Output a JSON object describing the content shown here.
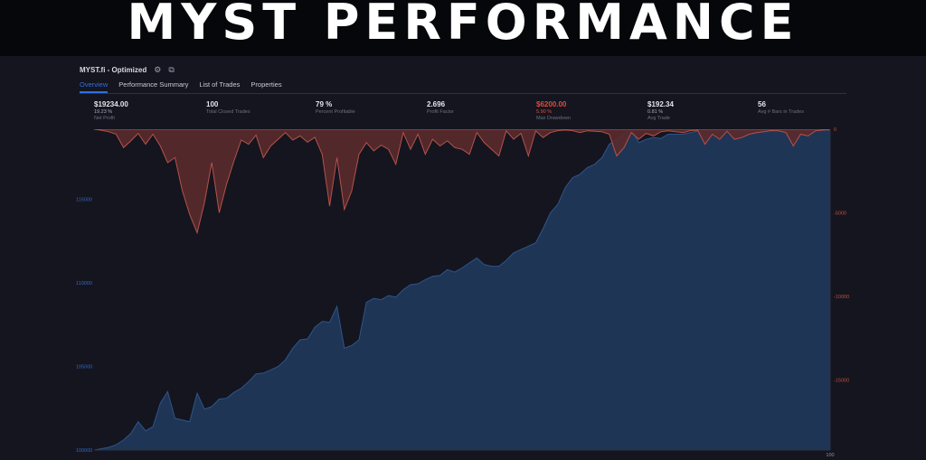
{
  "banner": {
    "title": "MYST PERFORMANCE"
  },
  "header": {
    "strategy_name": "MYST.fi - Optimized",
    "settings_icon": "gear-icon",
    "compare_icon": "chart-compare-icon"
  },
  "tabs": [
    {
      "label": "Overview",
      "active": true
    },
    {
      "label": "Performance Summary",
      "active": false
    },
    {
      "label": "List of Trades",
      "active": false
    },
    {
      "label": "Properties",
      "active": false
    }
  ],
  "metrics": [
    {
      "value": "$19234.00",
      "sub": "19.23 %",
      "label": "Net Profit"
    },
    {
      "value": "100",
      "sub": "",
      "label": "Total Closed Trades"
    },
    {
      "value": "79 %",
      "sub": "",
      "label": "Percent Profitable"
    },
    {
      "value": "2.696",
      "sub": "",
      "label": "Profit Factor"
    },
    {
      "value": "$6200.00",
      "sub": "5.90 %",
      "label": "Max Drawdown",
      "negative": true
    },
    {
      "value": "$192.34",
      "sub": "0.81 %",
      "label": "Avg Trade"
    },
    {
      "value": "56",
      "sub": "",
      "label": "Avg # Bars in Trades"
    }
  ],
  "colors": {
    "equity_fill": "#1f3556",
    "equity_line": "#2f5488",
    "drawdown_fill": "#5a2a2c",
    "drawdown_line": "#b5524a",
    "left_axis": "#3569c2",
    "right_axis": "#c0503f"
  },
  "chart_data": {
    "type": "area",
    "title": "",
    "x": [
      0,
      1,
      2,
      3,
      4,
      5,
      6,
      7,
      8,
      9,
      10,
      11,
      12,
      13,
      14,
      15,
      16,
      17,
      18,
      19,
      20,
      21,
      22,
      23,
      24,
      25,
      26,
      27,
      28,
      29,
      30,
      31,
      32,
      33,
      34,
      35,
      36,
      37,
      38,
      39,
      40,
      41,
      42,
      43,
      44,
      45,
      46,
      47,
      48,
      49,
      50,
      51,
      52,
      53,
      54,
      55,
      56,
      57,
      58,
      59,
      60,
      61,
      62,
      63,
      64,
      65,
      66,
      67,
      68,
      69,
      70,
      71,
      72,
      73,
      74,
      75,
      76,
      77,
      78,
      79,
      80,
      81,
      82,
      83,
      84,
      85,
      86,
      87,
      88,
      89,
      90,
      91,
      92,
      93,
      94,
      95,
      96,
      97,
      98,
      99,
      100
    ],
    "x_tick_labels": [
      "100"
    ],
    "left_axis": {
      "ticks": [
        {
          "value": 100000,
          "label": "100000"
        },
        {
          "value": 105000,
          "label": "105000"
        },
        {
          "value": 110000,
          "label": "110000"
        },
        {
          "value": 115000,
          "label": "115000"
        }
      ],
      "ylim": [
        100000,
        119200
      ]
    },
    "right_axis": {
      "ticks": [
        {
          "value": 0,
          "label": "0"
        },
        {
          "value": -5000,
          "label": "-5000"
        },
        {
          "value": -10000,
          "label": "-10000"
        },
        {
          "value": -15000,
          "label": "-15000"
        }
      ],
      "ylim": [
        -19200,
        0
      ]
    },
    "series": [
      {
        "type": "area",
        "axis": "left",
        "values": [
          100000,
          100080,
          100160,
          100320,
          100600,
          101000,
          101700,
          101150,
          101400,
          102800,
          103500,
          101900,
          101800,
          101700,
          103400,
          102450,
          102600,
          103050,
          103100,
          103450,
          103700,
          104100,
          104560,
          104600,
          104800,
          105000,
          105400,
          106100,
          106600,
          106650,
          107350,
          107700,
          107650,
          108600,
          106100,
          106250,
          106600,
          108850,
          109080,
          109000,
          109250,
          109150,
          109600,
          109900,
          109950,
          110200,
          110400,
          110450,
          110800,
          110650,
          110900,
          111200,
          111500,
          111100,
          111000,
          111000,
          111350,
          111800,
          112000,
          112200,
          112400,
          113250,
          114200,
          114700,
          115700,
          116300,
          116500,
          116900,
          117100,
          117500,
          118300,
          118600,
          118950,
          119200,
          118400,
          118600,
          118700,
          118650,
          118900,
          118900,
          118900,
          119000,
          119100,
          119600,
          120100,
          120500,
          120700,
          120700,
          121000,
          121200,
          121500,
          121600,
          121900,
          122150,
          122500,
          122600,
          122200,
          122300,
          122700,
          123000,
          123300
        ]
      },
      {
        "type": "area",
        "axis": "right",
        "values": [
          0,
          -60,
          -150,
          -300,
          -1100,
          -700,
          -250,
          -900,
          -300,
          -1000,
          -2000,
          -1700,
          -3700,
          -5100,
          -6200,
          -4400,
          -2000,
          -5000,
          -3300,
          -1900,
          -650,
          -900,
          -350,
          -1700,
          -1000,
          -600,
          -200,
          -650,
          -400,
          -780,
          -480,
          -1500,
          -4600,
          -1700,
          -4800,
          -3700,
          -1500,
          -800,
          -1300,
          -950,
          -1200,
          -2100,
          -200,
          -1200,
          -300,
          -1500,
          -600,
          -1000,
          -700,
          -1100,
          -1200,
          -1500,
          -200,
          -800,
          -1200,
          -1600,
          -100,
          -600,
          -250,
          -1600,
          -100,
          -500,
          -200,
          -80,
          -50,
          -80,
          -200,
          -90,
          -120,
          -150,
          -300,
          -1600,
          -1100,
          -200,
          -600,
          -250,
          -400,
          -150,
          -90,
          -150,
          -200,
          -80,
          -60,
          -900,
          -300,
          -600,
          -120,
          -600,
          -500,
          -300,
          -200,
          -150,
          -80,
          -100,
          -200,
          -1000,
          -300,
          -400,
          -100,
          -50,
          -30
        ]
      }
    ]
  }
}
